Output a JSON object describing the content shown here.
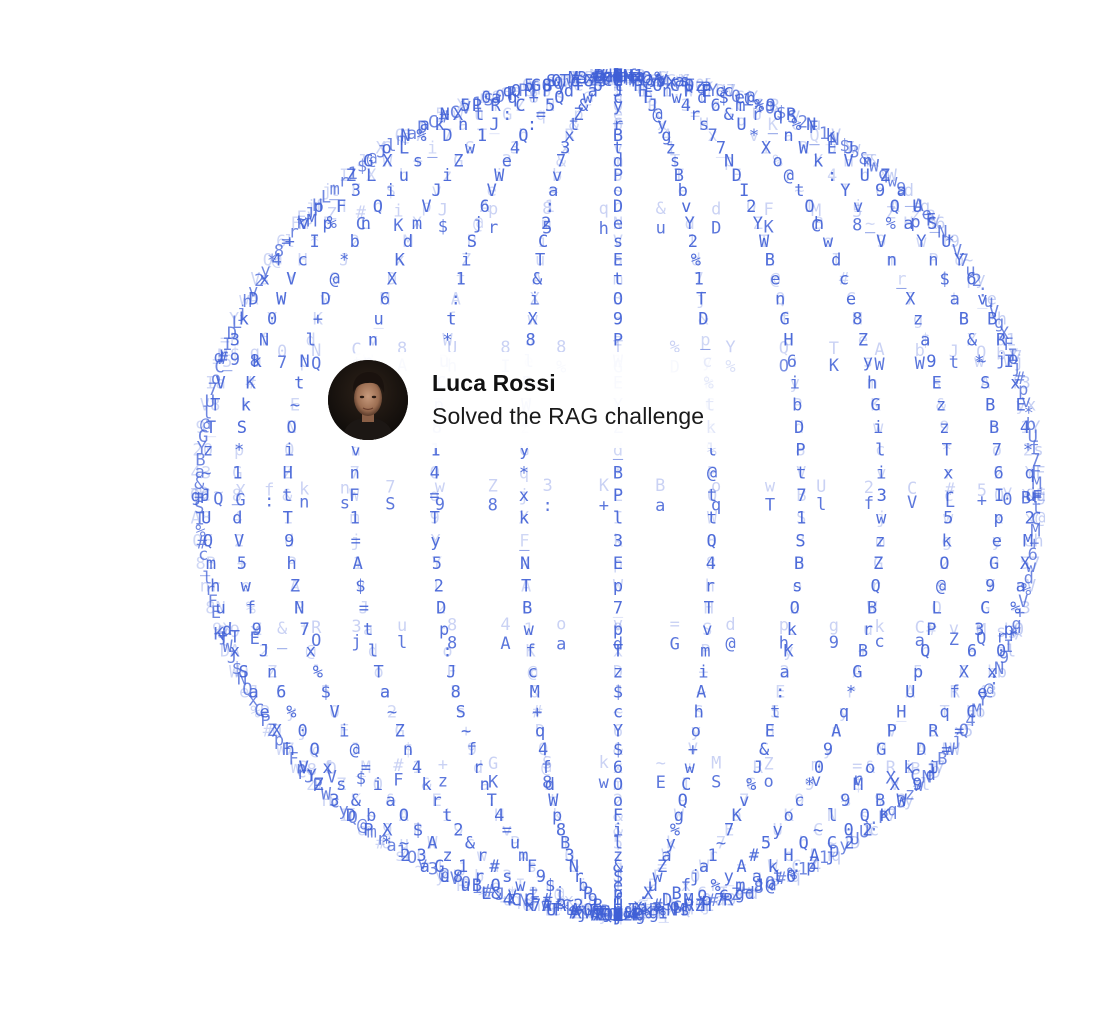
{
  "notification": {
    "name": "Luca Rossi",
    "message": "Solved the RAG challenge"
  },
  "globe": {
    "icon": "ascii-wireframe-globe",
    "color": "#3f5fd6",
    "glyphs": "aB3#xK9@pQ2~Z&mL7%eT5*R0jW+4VhdN8sGyC1=oF6:uIcE$kMfX_lYAtrPHwUbnDgvOiqJzS"
  }
}
